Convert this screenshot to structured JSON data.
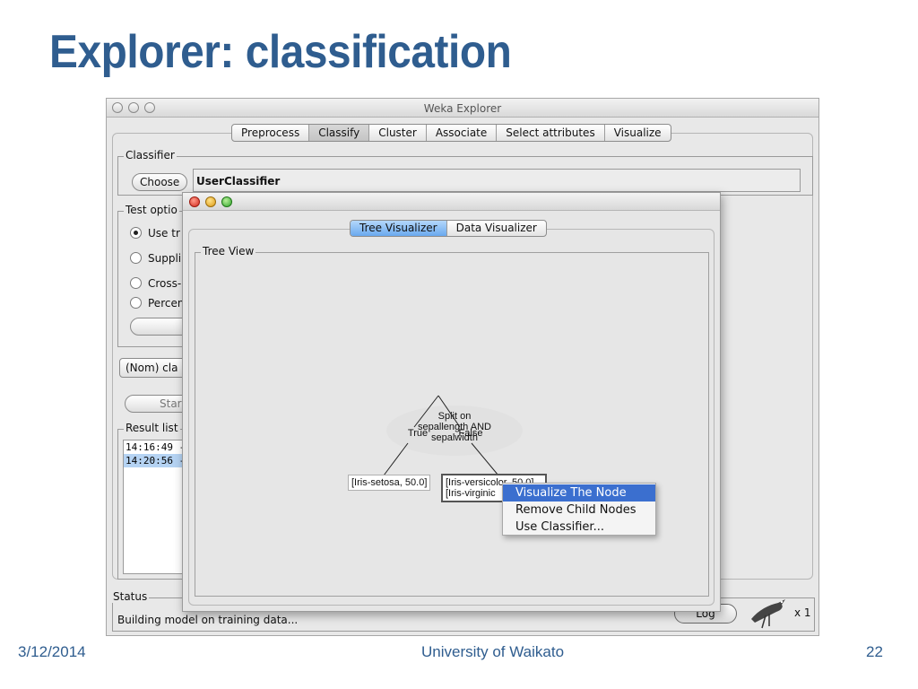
{
  "slide": {
    "title": "Explorer: classification",
    "footer_date": "3/12/2014",
    "footer_org": "University of Waikato",
    "footer_page": "22"
  },
  "weka": {
    "window_title": "Weka Explorer",
    "tabs": [
      "Preprocess",
      "Classify",
      "Cluster",
      "Associate",
      "Select attributes",
      "Visualize"
    ],
    "selected_tab": "Classify",
    "classifier": {
      "group_label": "Classifier",
      "choose_label": "Choose",
      "name": "UserClassifier"
    },
    "test_options": {
      "group_label": "Test optio",
      "options": [
        "Use tr",
        "Suppli",
        "Cross-",
        "Percen"
      ]
    },
    "class_select": "(Nom) cla",
    "start_label": "Star",
    "result_list": {
      "group_label": "Result list",
      "items": [
        "14:16:49 -",
        "14:20:56 -"
      ]
    },
    "status": {
      "group_label": "Status",
      "text": "Building model on training data..."
    },
    "log_label": "Log",
    "x_count": "x 1"
  },
  "tree_window": {
    "tabs": [
      "Tree Visualizer",
      "Data Visualizer"
    ],
    "selected_tab": "Tree Visualizer",
    "tree_view_label": "Tree View",
    "root_node": "Split on\nsepallength AND\nsepalwidth",
    "edge_true": "True",
    "edge_false": "False",
    "leaf_left": "[Iris-setosa, 50.0]",
    "leaf_right_line1": "[Iris-versicolor, 50.0]",
    "leaf_right_line2": "[Iris-virginic",
    "context_menu": [
      "Visualize The Node",
      "Remove Child Nodes",
      "Use Classifier..."
    ],
    "context_highlight": "Visualize The Node"
  },
  "colors": {
    "title_blue": "#2f5d8f",
    "selection_blue": "#3b6fcf",
    "result_highlight": "#b5d3f3"
  }
}
